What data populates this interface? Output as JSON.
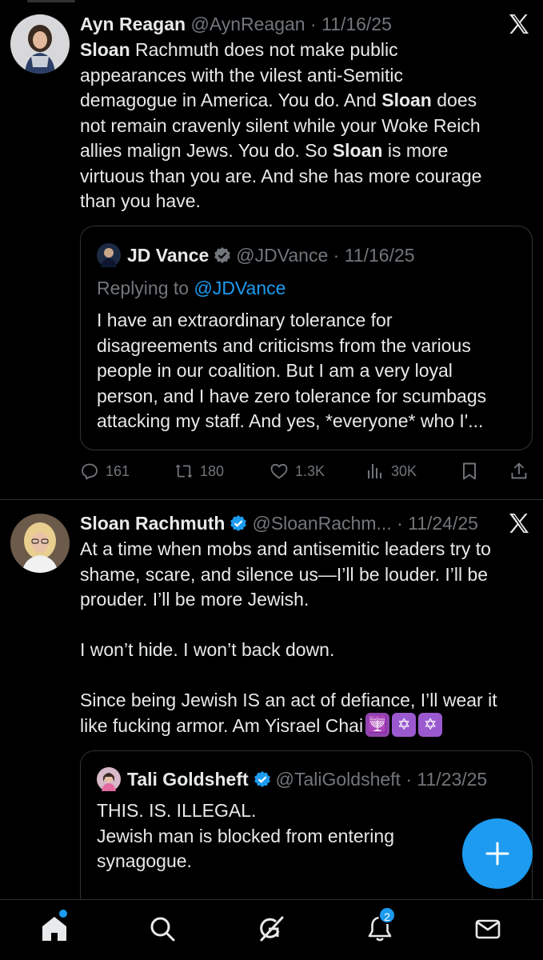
{
  "tweets": [
    {
      "author_name": "Ayn Reagan",
      "author_handle": "@AynReagan",
      "separator": "·",
      "date": "11/16/25",
      "text_lines": [
        {
          "segments": [
            {
              "t": "Sloan",
              "b": true
            },
            {
              "t": " Rachmuth does not make public",
              "b": false
            }
          ]
        },
        {
          "segments": [
            {
              "t": "appearances with the vilest anti-Semitic",
              "b": false
            }
          ]
        },
        {
          "segments": [
            {
              "t": "demagogue in America. You do. And ",
              "b": false
            },
            {
              "t": "Sloan",
              "b": true
            },
            {
              "t": " does",
              "b": false
            }
          ]
        },
        {
          "segments": [
            {
              "t": "not remain cravenly silent while your Woke Reich",
              "b": false
            }
          ]
        },
        {
          "segments": [
            {
              "t": "allies malign Jews. You do. So ",
              "b": false
            },
            {
              "t": "Sloan",
              "b": true
            },
            {
              "t": " is more",
              "b": false
            }
          ]
        },
        {
          "segments": [
            {
              "t": "virtuous than you are. And she has more courage",
              "b": false
            }
          ]
        },
        {
          "segments": [
            {
              "t": "than you have.",
              "b": false
            }
          ]
        }
      ],
      "quote": {
        "author_name": "JD Vance",
        "author_handle": "@JDVance",
        "separator": "·",
        "date": "11/16/25",
        "replying_prefix": "Replying to ",
        "replying_to": "@JDVance",
        "text_lines": [
          "I have an extraordinary tolerance for",
          "disagreements and criticisms from the various",
          "people in our coalition. But I am a very loyal",
          "person, and I have zero tolerance for scumbags",
          "attacking my staff. And yes, *everyone* who I'..."
        ]
      },
      "actions": {
        "replies": "161",
        "retweets": "180",
        "likes": "1.3K",
        "views": "30K"
      }
    },
    {
      "author_name": "Sloan Rachmuth",
      "author_handle": "@SloanRachm...",
      "separator": "·",
      "date": "11/24/25",
      "text_lines": [
        "At a time when mobs and antisemitic leaders try to",
        "shame, scare, and silence us—I’ll be louder. I’ll be",
        "prouder. I’ll be more Jewish.",
        "",
        "I won’t hide. I won’t back down.",
        "",
        "Since being Jewish IS an act of defiance, I’ll wear it",
        "like fucking armor.  Am Yisrael Chai"
      ],
      "emojis": [
        "🕎",
        "✡",
        "✡"
      ],
      "quote": {
        "author_name": "Tali Goldsheft",
        "author_handle": "@TaliGoldsheft",
        "separator": "·",
        "date": "11/23/25",
        "text_lines": [
          "THIS. IS. ILLEGAL.",
          "",
          "Jewish man is blocked from entering",
          "synagogue."
        ]
      }
    }
  ],
  "nav": {
    "notification_count": "2"
  },
  "icons": {
    "close": "x-logo-icon",
    "reply": "reply-icon",
    "retweet": "retweet-icon",
    "like": "heart-icon",
    "views": "views-icon",
    "bookmark": "bookmark-icon",
    "share": "share-icon",
    "compose": "plus-icon",
    "home": "home-icon",
    "search": "search-icon",
    "grok": "grok-icon",
    "notifications": "bell-icon",
    "messages": "mail-icon"
  },
  "colors": {
    "background": "#000000",
    "text": "#e7e9ea",
    "muted": "#71767b",
    "accent": "#1d9bf0",
    "border": "#2f3336"
  }
}
